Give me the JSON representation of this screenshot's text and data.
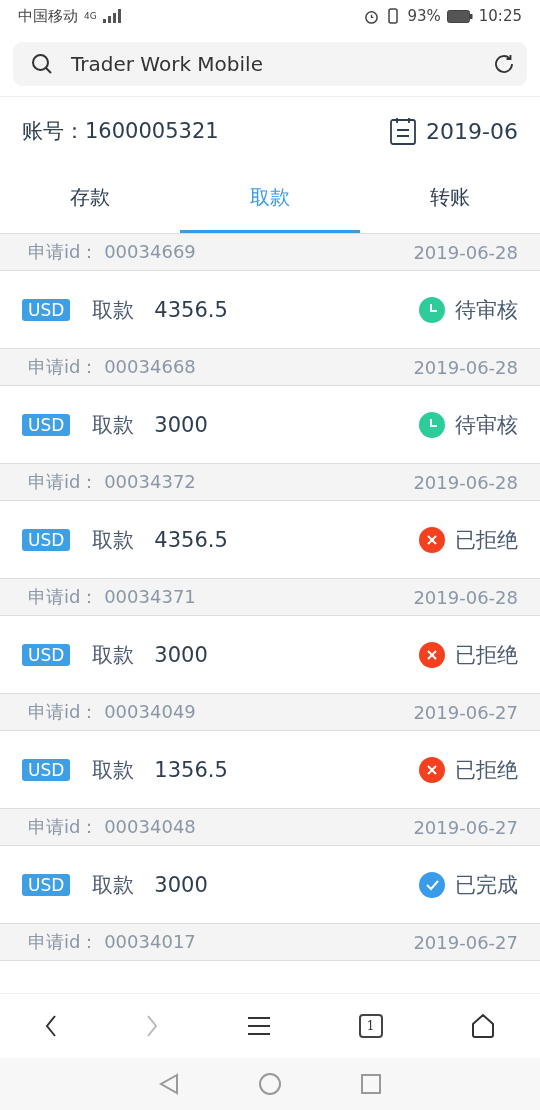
{
  "status_bar": {
    "carrier": "中国移动",
    "network": "4G",
    "battery": "93%",
    "time": "10:25"
  },
  "browser": {
    "address": "Trader Work Mobile"
  },
  "account": {
    "label": "账号：",
    "number": "1600005321",
    "month": "2019-06"
  },
  "tabs": [
    {
      "label": "存款",
      "selected": false
    },
    {
      "label": "取款",
      "selected": true
    },
    {
      "label": "转账",
      "selected": false
    }
  ],
  "requests": [
    {
      "id_label": "申请id：",
      "id": "00034669",
      "date": "2019-06-28",
      "currency": "USD",
      "type": "取款",
      "amount": "4356.5",
      "kind": "pending",
      "status_text": "待审核"
    },
    {
      "id_label": "申请id：",
      "id": "00034668",
      "date": "2019-06-28",
      "currency": "USD",
      "type": "取款",
      "amount": "3000",
      "kind": "pending",
      "status_text": "待审核"
    },
    {
      "id_label": "申请id：",
      "id": "00034372",
      "date": "2019-06-28",
      "currency": "USD",
      "type": "取款",
      "amount": "4356.5",
      "kind": "rejected",
      "status_text": "已拒绝"
    },
    {
      "id_label": "申请id：",
      "id": "00034371",
      "date": "2019-06-28",
      "currency": "USD",
      "type": "取款",
      "amount": "3000",
      "kind": "rejected",
      "status_text": "已拒绝"
    },
    {
      "id_label": "申请id：",
      "id": "00034049",
      "date": "2019-06-27",
      "currency": "USD",
      "type": "取款",
      "amount": "1356.5",
      "kind": "rejected",
      "status_text": "已拒绝"
    },
    {
      "id_label": "申请id：",
      "id": "00034048",
      "date": "2019-06-27",
      "currency": "USD",
      "type": "取款",
      "amount": "3000",
      "kind": "done",
      "status_text": "已完成"
    },
    {
      "id_label": "申请id：",
      "id": "00034017",
      "date": "2019-06-27"
    }
  ],
  "bottom_nav": {
    "tab_count": "1"
  }
}
